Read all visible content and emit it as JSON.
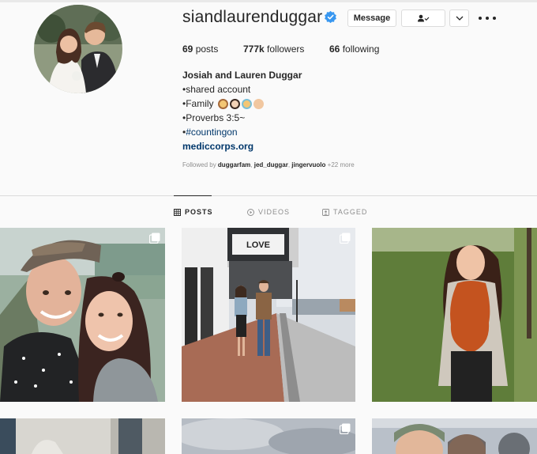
{
  "profile": {
    "username": "siandlaurenduggar",
    "verified_icon": "verified-badge-icon",
    "message_label": "Message",
    "follow_icon": "person-check-icon",
    "chevron_icon": "chevron-down-icon",
    "more_icon": "more-dots-icon",
    "avatar_icon": "profile-photo"
  },
  "stats": {
    "posts_count": "69",
    "posts_label": "posts",
    "followers_count": "777k",
    "followers_label": "followers",
    "following_count": "66",
    "following_label": "following"
  },
  "bio": {
    "name": "Josiah and Lauren Duggar",
    "line1": "•shared account",
    "line2": "•Family",
    "line3": "•Proverbs 3:5~",
    "line4_prefix": "•",
    "hashtag": "#countingon",
    "link": "mediccorps.org",
    "family_emojis": [
      "man-emoji",
      "woman-emoji",
      "man-emoji",
      "baby-emoji"
    ]
  },
  "followed_by": {
    "prefix": "Followed by",
    "user1": "duggarfam",
    "user2": "jed_duggar",
    "user3": "jingervuolo",
    "more": "+22 more"
  },
  "tabs": {
    "posts": "POSTS",
    "videos": "VIDEOS",
    "tagged": "TAGGED",
    "active": "posts"
  },
  "grid": {
    "tiles": [
      {
        "name": "selfie-couple",
        "multi": true
      },
      {
        "name": "couple-street-theater",
        "multi": true,
        "marquee": "LOVE"
      },
      {
        "name": "pregnant-outdoors",
        "multi": false
      },
      {
        "name": "interior-photo",
        "multi": false
      },
      {
        "name": "sky-photo",
        "multi": true
      },
      {
        "name": "group-photo",
        "multi": false
      }
    ]
  },
  "colors": {
    "accent": "#3897f0",
    "link": "#00376b",
    "muted": "#8e8e8e"
  }
}
